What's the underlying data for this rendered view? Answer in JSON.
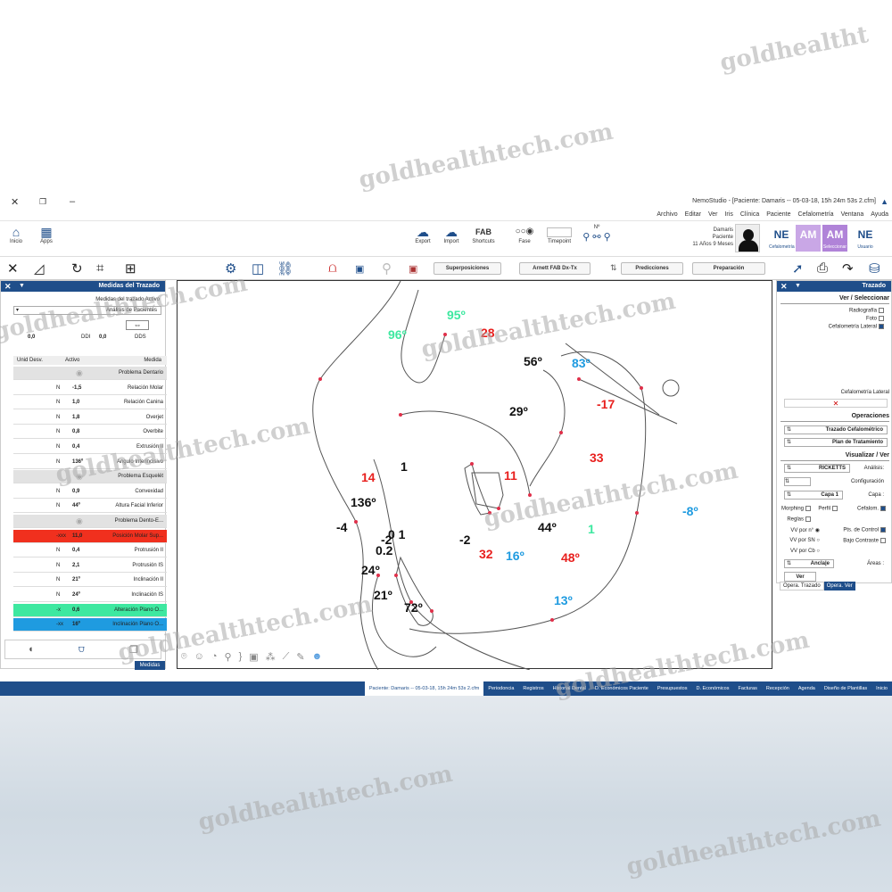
{
  "window": {
    "title": "NemoStudio - [Paciente: Damaris -- 05-03-18, 15h 24m 53s 2.cfm]",
    "menu": [
      "Archivo",
      "Editar",
      "Ver",
      "Iris",
      "Clínica",
      "Paciente",
      "Cefalometría",
      "Ventana",
      "Ayuda"
    ]
  },
  "ribbon": {
    "home_label": "Inicio",
    "apps_label": "Apps",
    "export_label": "Export",
    "import_label": "Import",
    "shortcuts_label": "Shortcuts",
    "fab_label": "FAB",
    "fase_label": "Fase",
    "timepoint_label": "Timepoint",
    "no_label": "Nº",
    "patient_name": "Damaris",
    "patient_role": "Paciente",
    "patient_age": "11 Años 9 Meses",
    "tiles": [
      {
        "text": "NE",
        "sub": "Cefalometría",
        "color": "#1f4e8a",
        "bg": "#ffffff"
      },
      {
        "text": "AM",
        "sub": "",
        "color": "#ffffff",
        "bg": "#c9a7e6"
      },
      {
        "text": "AM",
        "sub": "Seleccionar",
        "color": "#ffffff",
        "bg": "#b083d8"
      },
      {
        "text": "NE",
        "sub": "Usuario",
        "color": "#1f4e8a",
        "bg": "#ffffff"
      }
    ]
  },
  "toolbar": {
    "buttons": [
      "Superposiciones",
      "Arnett FAB Dx-Tx",
      "Predicciones",
      "Preparación"
    ]
  },
  "left_panel": {
    "title": "Medidas del Trazado",
    "subtitle": "Medidas del trazado Activo",
    "analysis_select": "Análisis de Pacientes",
    "dds_label": "DDS",
    "ddi_label": "DDI",
    "dds_value": "0,0",
    "ddi_value": "0,0",
    "headers": {
      "medida": "Medida",
      "activo": "Activo",
      "unid": "Unid Desv."
    },
    "rows": [
      {
        "type": "section",
        "medida": "Problema Dentario"
      },
      {
        "medida": "Relación Molar",
        "activo": "-1,5",
        "unid": "N"
      },
      {
        "medida": "Relación Canina",
        "activo": "1,0",
        "unid": "N"
      },
      {
        "medida": "Overjet",
        "activo": "1,8",
        "unid": "N"
      },
      {
        "medida": "Overbite",
        "activo": "0,8",
        "unid": "N"
      },
      {
        "medida": "Extrusión II",
        "activo": "0,4",
        "unid": "N"
      },
      {
        "medida": "Angulo Interincisivo",
        "activo": "136º",
        "unid": "N"
      },
      {
        "type": "section",
        "medida": "Problema Esquelét"
      },
      {
        "medida": "Convexidad",
        "activo": "0,9",
        "unid": "N"
      },
      {
        "medida": "Altura Facial Inferior",
        "activo": "44º",
        "unid": "N"
      },
      {
        "type": "section",
        "medida": "Problema Dento-E..."
      },
      {
        "medida": "Posición Molar Sup...",
        "activo": "11,0",
        "unid": "-xxx",
        "highlight": "#f0301e"
      },
      {
        "medida": "Protrusión II",
        "activo": "0,4",
        "unid": "N"
      },
      {
        "medida": "Protrusión IS",
        "activo": "2,1",
        "unid": "N"
      },
      {
        "medida": "Inclinación II",
        "activo": "21º",
        "unid": "N"
      },
      {
        "medida": "Inclinación IS",
        "activo": "24º",
        "unid": "N"
      },
      {
        "medida": "Alteración Plano O...",
        "activo": "0,6",
        "unid": "-x",
        "highlight": "#3ee8a0"
      },
      {
        "medida": "Inclinación Plano O...",
        "activo": "16º",
        "unid": "-xx",
        "highlight": "#1f9be0"
      }
    ],
    "footer_tab": "Medidas"
  },
  "right_panel": {
    "title": "Trazado",
    "view_section": "Ver / Seleccionar",
    "view_items": [
      "Radiografía",
      "Foto",
      "Cefalometría Lateral"
    ],
    "selected_item": "Cefalometría Lateral",
    "ops_section": "Operaciones",
    "trazado_select": "Trazado Cefalométrico",
    "plan_select": "Plan de Tratamiento",
    "visual_section": "Visualizar / Ver",
    "analisis_label": "Análisis:",
    "analisis_value": "RICKETTS",
    "config_label": "Configuración",
    "capa_label": "Capa :",
    "capa_value": "Capa 1",
    "cefalom_label": "Cefalom.",
    "perfil_label": "Perfil",
    "morphing_label": "Morphing",
    "reglas_label": "Reglas",
    "pts_label": "Pts. de Control",
    "bajo_label": "Bajo Contraste",
    "vv_n": "VV por n°",
    "vv_sn": "VV por SN",
    "vv_cb": "VV por Cb",
    "areas_label": "Áreas :",
    "areas_value": "Ancla|e",
    "ver_button": "Ver",
    "tab_ops_ver": "Opera. Ver",
    "tab_ops_trazado": "Opera. Trazado"
  },
  "canvas_labels": [
    {
      "text": "95º",
      "color": "#3ee8a0"
    },
    {
      "text": "96º",
      "color": "#3ee8a0"
    },
    {
      "text": "28",
      "color": "#e8201e"
    },
    {
      "text": "56º",
      "color": "#111111"
    },
    {
      "text": "83º",
      "color": "#1f9be0"
    },
    {
      "text": "-17",
      "color": "#e8201e"
    },
    {
      "text": "29º",
      "color": "#111111"
    },
    {
      "text": "33",
      "color": "#e8201e"
    },
    {
      "text": "14",
      "color": "#e8201e"
    },
    {
      "text": "1",
      "color": "#111111"
    },
    {
      "text": "11",
      "color": "#e8201e"
    },
    {
      "text": "136º",
      "color": "#111111"
    },
    {
      "text": "-8º",
      "color": "#1f9be0"
    },
    {
      "text": "-4",
      "color": "#111111"
    },
    {
      "text": "0 1",
      "color": "#111111"
    },
    {
      "text": "0.2",
      "color": "#111111"
    },
    {
      "text": "-2",
      "color": "#111111"
    },
    {
      "text": "44º",
      "color": "#111111"
    },
    {
      "text": "1",
      "color": "#3ee8a0"
    },
    {
      "text": "-2",
      "color": "#111111"
    },
    {
      "text": "32",
      "color": "#e8201e"
    },
    {
      "text": "16º",
      "color": "#1f9be0"
    },
    {
      "text": "48º",
      "color": "#e8201e"
    },
    {
      "text": "24º",
      "color": "#111111"
    },
    {
      "text": "21º",
      "color": "#111111"
    },
    {
      "text": "72º",
      "color": "#111111"
    },
    {
      "text": "13º",
      "color": "#1f9be0"
    }
  ],
  "taskbar_tabs": [
    {
      "label": "Inicio"
    },
    {
      "label": "Diseño de Plantillas"
    },
    {
      "label": "Agenda"
    },
    {
      "label": "Recepción"
    },
    {
      "label": "Facturas"
    },
    {
      "label": "D. Económicos"
    },
    {
      "label": "Presupuestos"
    },
    {
      "label": "D. Económicos Paciente"
    },
    {
      "label": "Historial Dental"
    },
    {
      "label": "Registros"
    },
    {
      "label": "Periodoncia"
    },
    {
      "label": "Paciente: Damaris -- 05-03-18, 15h 24m 53s 2.cfm",
      "active": true
    }
  ],
  "watermark": "goldhealthtech.com",
  "watermark_short": "goldhealtht"
}
